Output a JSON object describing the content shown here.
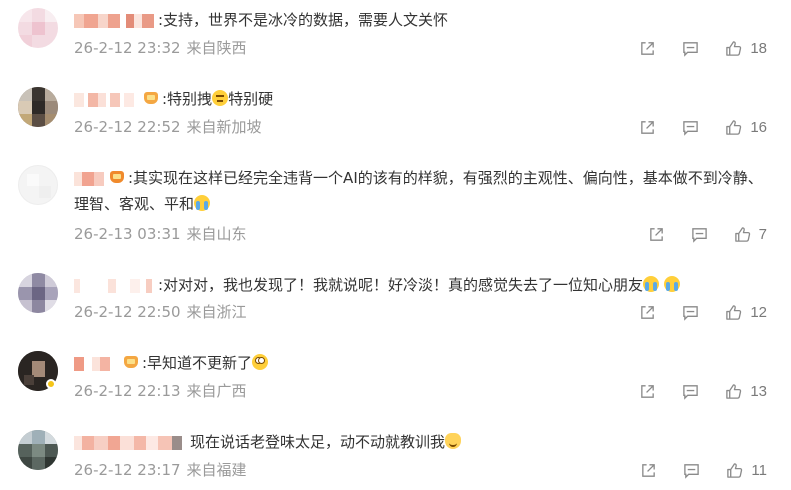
{
  "comments": [
    {
      "text": ":支持，世界不是冰冷的数据，需要人文关怀",
      "time": "26-2-12 23:32",
      "location": "来自陕西",
      "likes": "18"
    },
    {
      "text_a": ":特别拽",
      "text_b": "特别硬",
      "time": "26-2-12 22:52",
      "location": "来自新加坡",
      "likes": "16"
    },
    {
      "text": ":其实现在这样已经完全违背一个AI的该有的样貌，有强烈的主观性、偏向性，基本做不到冷静、理智、客观、平和",
      "time": "26-2-13 03:31",
      "location": "来自山东",
      "likes": "7"
    },
    {
      "text": ":对对对，我也发现了！我就说呢！好冷淡！真的感觉失去了一位知心朋友",
      "time": "26-2-12 22:50",
      "location": "来自浙江",
      "likes": "12"
    },
    {
      "text": ":早知道不更新了",
      "time": "26-2-12 22:13",
      "location": "来自广西",
      "likes": "13"
    },
    {
      "text": "现在说话老登味太足，动不动就教训我",
      "time": "26-2-12 23:17",
      "location": "来自福建",
      "likes": "11"
    }
  ],
  "icons": {
    "share": "share-icon",
    "comment": "comment-icon",
    "like": "thumbs-up-icon"
  },
  "colors": {
    "meta_text": "#9a9a9a",
    "body_text": "#333333",
    "icon": "#8a8a8a"
  }
}
